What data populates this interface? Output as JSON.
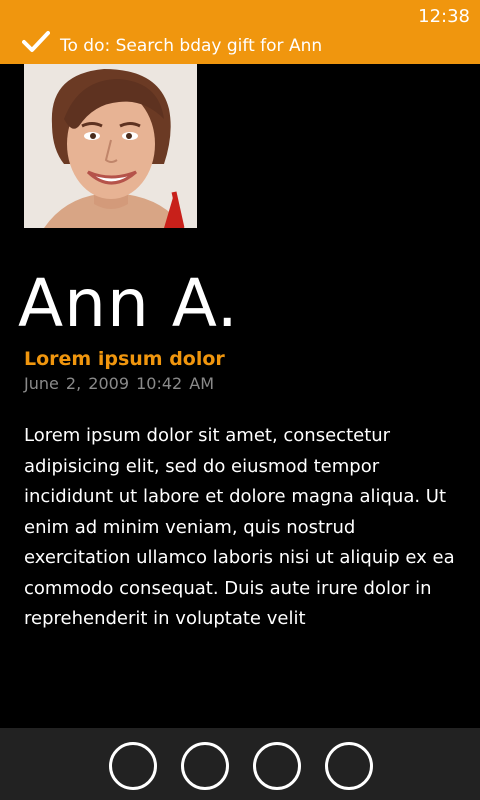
{
  "status_bar": {
    "time": "12:38"
  },
  "notification": {
    "icon": "checkmark-icon",
    "text": "To do: Search bday gift for Ann",
    "color": "#F0960E"
  },
  "contact": {
    "name": "Ann A.",
    "photo": "contact-photo"
  },
  "message": {
    "subject": "Lorem ipsum dolor",
    "datetime": "June 2, 2009  10:42 AM",
    "body": "Lorem ipsum dolor sit amet, consectetur adipisicing elit, sed do eiusmod tempor incididunt ut labore et dolore magna aliqua. Ut enim ad minim veniam, quis nostrud exercitation ullamco laboris nisi ut aliquip ex ea commodo consequat. Duis aute irure dolor in reprehenderit in voluptate velit"
  },
  "app_bar": {
    "buttons": [
      "app-bar-button-1",
      "app-bar-button-2",
      "app-bar-button-3",
      "app-bar-button-4"
    ]
  },
  "colors": {
    "accent": "#F0960E",
    "background": "#000000",
    "app_bar": "#222222",
    "secondary_text": "#8a8a8a"
  }
}
